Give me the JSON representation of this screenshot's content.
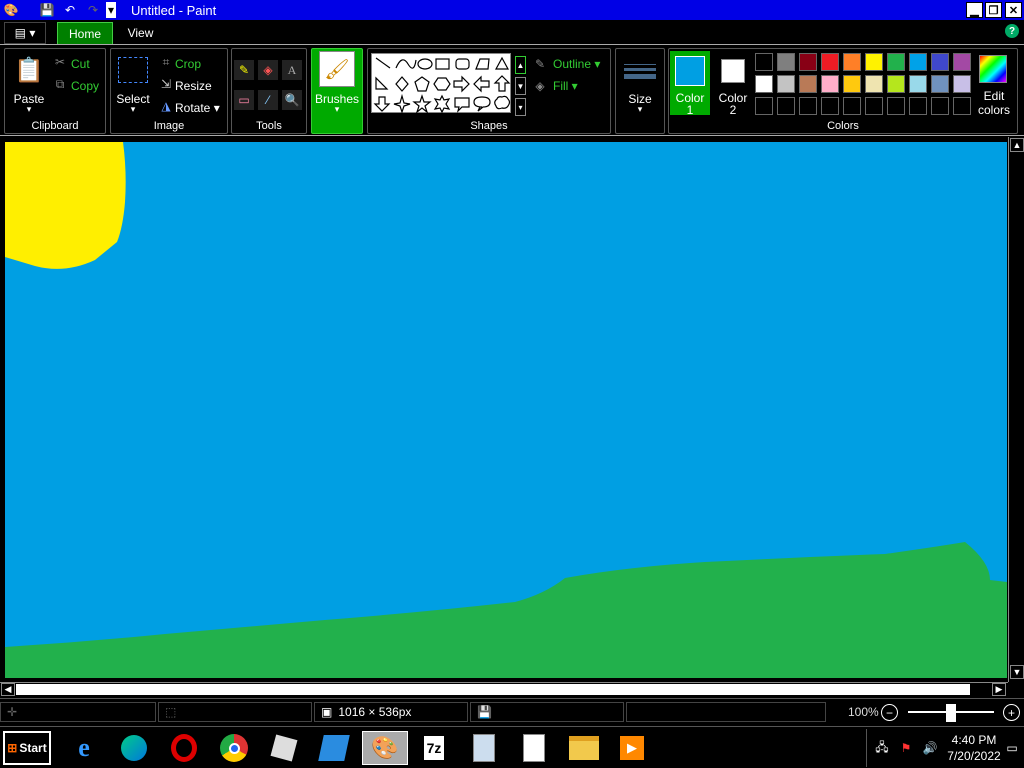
{
  "window": {
    "title": "Untitled - Paint"
  },
  "tabs": {
    "home": "Home",
    "view": "View"
  },
  "clipboard": {
    "paste": "Paste",
    "cut": "Cut",
    "copy": "Copy",
    "label": "Clipboard"
  },
  "image": {
    "select": "Select",
    "crop": "Crop",
    "resize": "Resize",
    "rotate": "Rotate",
    "label": "Image"
  },
  "tools": {
    "label": "Tools"
  },
  "brushes": {
    "label": "Brushes"
  },
  "shapes": {
    "outline": "Outline",
    "fill": "Fill",
    "label": "Shapes"
  },
  "size": {
    "label": "Size"
  },
  "colors": {
    "color1_label": "Color",
    "color1_num": "1",
    "color2_label": "Color",
    "color2_num": "2",
    "edit_label": "Edit",
    "edit_label2": "colors",
    "label": "Colors",
    "color1": "#009fe3",
    "color2": "#ffffff",
    "row1": [
      "#000000",
      "#7f7f7f",
      "#880015",
      "#ed1c24",
      "#ff7f27",
      "#fff200",
      "#22b14c",
      "#00a2e8",
      "#3f48cc",
      "#a349a4"
    ],
    "row2": [
      "#ffffff",
      "#c3c3c3",
      "#b97a57",
      "#ffaec9",
      "#ffc90e",
      "#efe4b0",
      "#b5e61d",
      "#99d9ea",
      "#7092be",
      "#c8bfe7"
    ]
  },
  "canvas": {
    "sky": "#009fe3",
    "sun": "#ffef00",
    "ground": "#22b14c"
  },
  "statusbar": {
    "dimensions": "1016 × 536px",
    "zoom": "100%"
  },
  "taskbar": {
    "start": "Start",
    "time": "4:40 PM",
    "date": "7/20/2022"
  }
}
